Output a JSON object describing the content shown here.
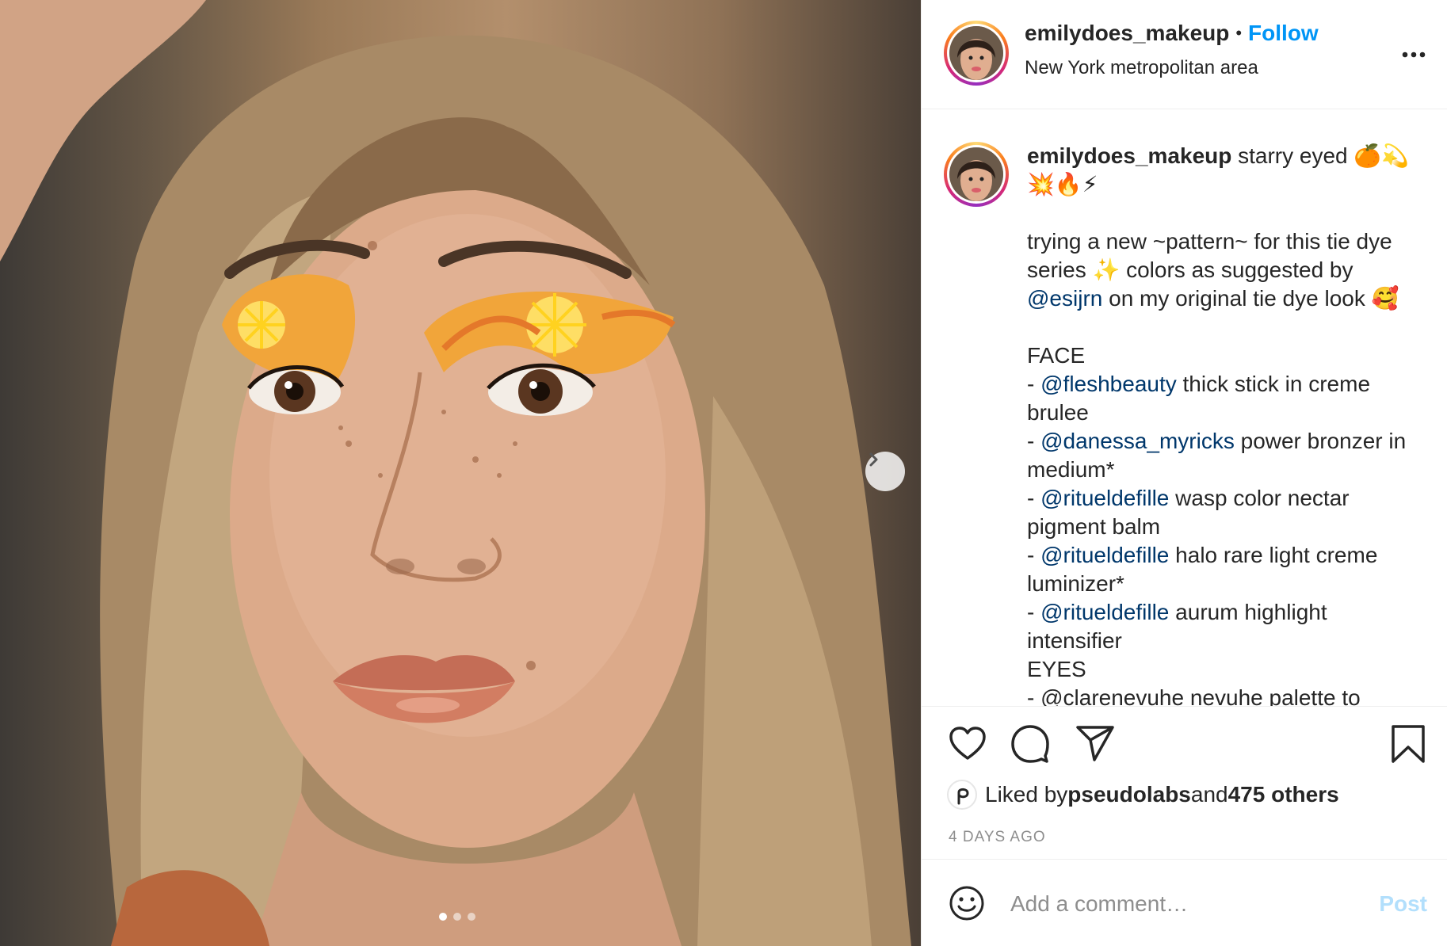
{
  "post": {
    "username": "emilydoes_makeup",
    "separator": "•",
    "follow_label": "Follow",
    "location": "New York metropolitan area",
    "more_icon": "more-horizontal-icon"
  },
  "carousel": {
    "slide_count": 3,
    "active_index": 0,
    "next_icon": "chevron-right-icon"
  },
  "caption": {
    "username": "emilydoes_makeup",
    "line1": " starry eyed 🍊💫",
    "line2": "💥🔥⚡",
    "para1_a": "trying a new ~pattern~ for this tie dye series ✨ colors as suggested by ",
    "para1_mention": "@esijrn",
    "para1_b": " on my original tie dye look 🥰",
    "face_heading": "FACE",
    "items": [
      {
        "prefix": "- ",
        "mention": "@fleshbeauty",
        "text": " thick stick in creme brulee"
      },
      {
        "prefix": "- ",
        "mention": "@danessa_myricks",
        "text": " power bronzer in medium*"
      },
      {
        "prefix": "- ",
        "mention": "@ritueldefille",
        "text": " wasp color nectar pigment balm"
      },
      {
        "prefix": "- ",
        "mention": "@ritueldefille",
        "text": " halo rare light creme luminizer*"
      },
      {
        "prefix": "- ",
        "mention": "@ritueldefille",
        "text": " aurum highlight intensifier"
      }
    ],
    "eyes_heading": "EYES",
    "eyes_partial": "- @clarenevuhe nevuhe palette to"
  },
  "actions": {
    "like_icon": "heart-icon",
    "comment_icon": "comment-icon",
    "share_icon": "paper-plane-icon",
    "save_icon": "bookmark-icon"
  },
  "likes": {
    "prefix": "Liked by ",
    "liker": "pseudolabs",
    "middle": " and ",
    "count_text": "475 others"
  },
  "timestamp": "4 DAYS AGO",
  "comment": {
    "emoji_icon": "smiley-icon",
    "placeholder": "Add a comment…",
    "post_label": "Post"
  },
  "colors": {
    "follow": "#0095f6",
    "mention": "#00376b",
    "post_disabled": "#b2dffc",
    "muted": "#8e8e8e"
  }
}
